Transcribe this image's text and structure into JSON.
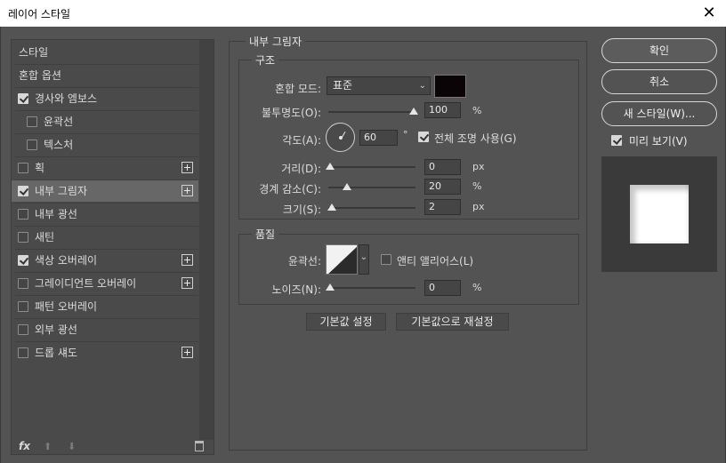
{
  "window": {
    "title": "레이어 스타일",
    "close_glyph": "✕"
  },
  "left_list": {
    "items": [
      {
        "label": "스타일",
        "checkbox": null,
        "plus": false,
        "selected": false
      },
      {
        "label": "혼합 옵션",
        "checkbox": null,
        "plus": false,
        "selected": false
      },
      {
        "label": "경사와 엠보스",
        "checkbox": true,
        "plus": false,
        "selected": false
      },
      {
        "label": "윤곽선",
        "checkbox": false,
        "plus": false,
        "selected": false,
        "indent": true
      },
      {
        "label": "텍스처",
        "checkbox": false,
        "plus": false,
        "selected": false,
        "indent": true
      },
      {
        "label": "획",
        "checkbox": false,
        "plus": true,
        "selected": false
      },
      {
        "label": "내부 그림자",
        "checkbox": true,
        "plus": true,
        "selected": true
      },
      {
        "label": "내부 광선",
        "checkbox": false,
        "plus": false,
        "selected": false
      },
      {
        "label": "새틴",
        "checkbox": false,
        "plus": false,
        "selected": false
      },
      {
        "label": "색상 오버레이",
        "checkbox": true,
        "plus": true,
        "selected": false
      },
      {
        "label": "그레이디언트 오버레이",
        "checkbox": false,
        "plus": true,
        "selected": false
      },
      {
        "label": "패턴 오버레이",
        "checkbox": false,
        "plus": false,
        "selected": false
      },
      {
        "label": "외부 광선",
        "checkbox": false,
        "plus": false,
        "selected": false
      },
      {
        "label": "드롭 섀도",
        "checkbox": false,
        "plus": true,
        "selected": false
      }
    ],
    "bottom": {
      "fx_label": "fx",
      "up_glyph": "⬆",
      "down_glyph": "⬇",
      "trash_icon": "trash-icon"
    }
  },
  "inner_shadow": {
    "section_title": "내부 그림자",
    "structure": {
      "title": "구조",
      "blend_mode_label": "혼합 모드:",
      "blend_mode_value": "표준",
      "shadow_color": "#0a0406",
      "opacity_label": "불투명도(O):",
      "opacity_value": "100",
      "opacity_unit": "%",
      "angle_label": "각도(A):",
      "angle_value": "60",
      "angle_unit": "°",
      "global_light_label": "전체 조명 사용(G)",
      "global_light_checked": true,
      "distance_label": "거리(D):",
      "distance_value": "0",
      "distance_unit": "px",
      "choke_label": "경계 감소(C):",
      "choke_value": "20",
      "choke_unit": "%",
      "size_label": "크기(S):",
      "size_value": "2",
      "size_unit": "px"
    },
    "quality": {
      "title": "품질",
      "contour_label": "윤곽선:",
      "anti_alias_label": "앤티 앨리어스(L)",
      "anti_alias_checked": false,
      "noise_label": "노이즈(N):",
      "noise_value": "0",
      "noise_unit": "%"
    },
    "make_default_label": "기본값 설정",
    "reset_default_label": "기본값으로 재설정"
  },
  "right": {
    "ok_label": "확인",
    "cancel_label": "취소",
    "new_style_label": "새 스타일(W)...",
    "preview_label": "미리 보기(V)",
    "preview_checked": true
  }
}
